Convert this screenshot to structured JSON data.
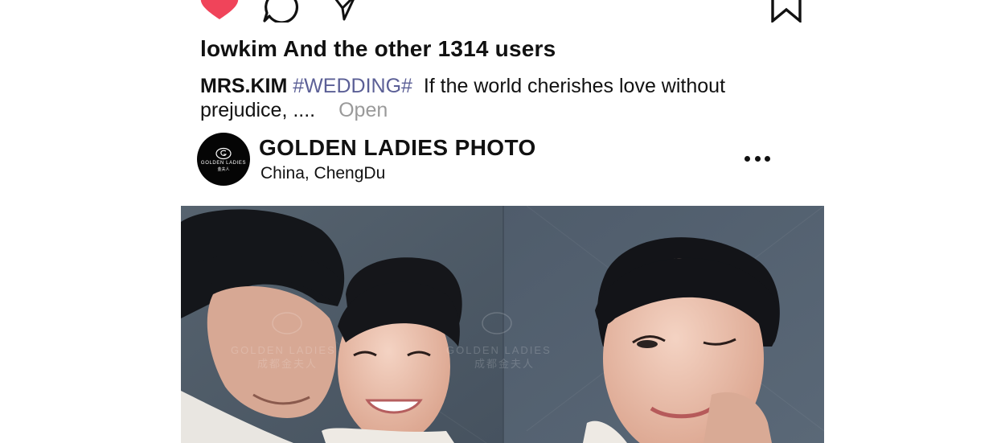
{
  "actions": {
    "like_icon": "heart-filled-icon",
    "comment_icon": "comment-bubble-icon",
    "share_icon": "paper-plane-icon",
    "save_icon": "bookmark-icon",
    "like_color": "#f0445a"
  },
  "likes": {
    "text": "lowkim And the other 1314 users"
  },
  "caption": {
    "username": "MRS.KIM",
    "hashtag": "#WEDDING#",
    "text": "If the world cherishes love without prejudice, ....",
    "more_label": "Open"
  },
  "profile": {
    "name": "GOLDEN LADIES PHOTO",
    "location": "China,  ChengDu",
    "avatar_text": "GOLDEN LADIES",
    "avatar_subtext": "金夫人",
    "more_icon": "more-dots-icon"
  },
  "photo": {
    "watermark_brand": "GOLDEN LADIES",
    "watermark_cn": "成都金夫人",
    "colors": {
      "background": "#4d5a69",
      "hair": "#15161a",
      "skin": "#e8bca6"
    }
  }
}
